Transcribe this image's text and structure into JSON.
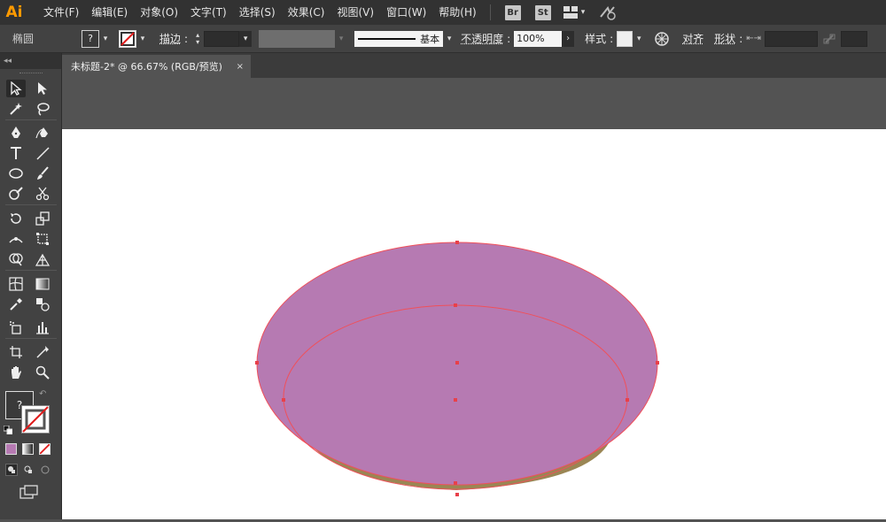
{
  "app": {
    "logo": "Ai"
  },
  "menu": [
    "文件(F)",
    "编辑(E)",
    "对象(O)",
    "文字(T)",
    "选择(S)",
    "效果(C)",
    "视图(V)",
    "窗口(W)",
    "帮助(H)"
  ],
  "bridge_badges": {
    "br": "Br",
    "st": "St"
  },
  "control_bar": {
    "object_type": "椭圆",
    "fill_swatch_symbol": "?",
    "stroke_label": "描边",
    "stroke_profile": "基本",
    "opacity_label": "不透明度",
    "opacity_value": "100%",
    "style_label": "样式",
    "align_label": "对齐",
    "shape_label": "形状"
  },
  "document": {
    "tab_title": "未标题-2* @ 66.67% (RGB/预览)",
    "close_symbol": "×"
  },
  "toolbar": {
    "collapse_label": "◂◂",
    "fill_swatch_symbol": "?"
  },
  "artwork": {
    "fill_color": "#b67ab2",
    "side_color": "#9a8654",
    "path_color": "#f0505a",
    "anchor_color": "#e8404a"
  }
}
